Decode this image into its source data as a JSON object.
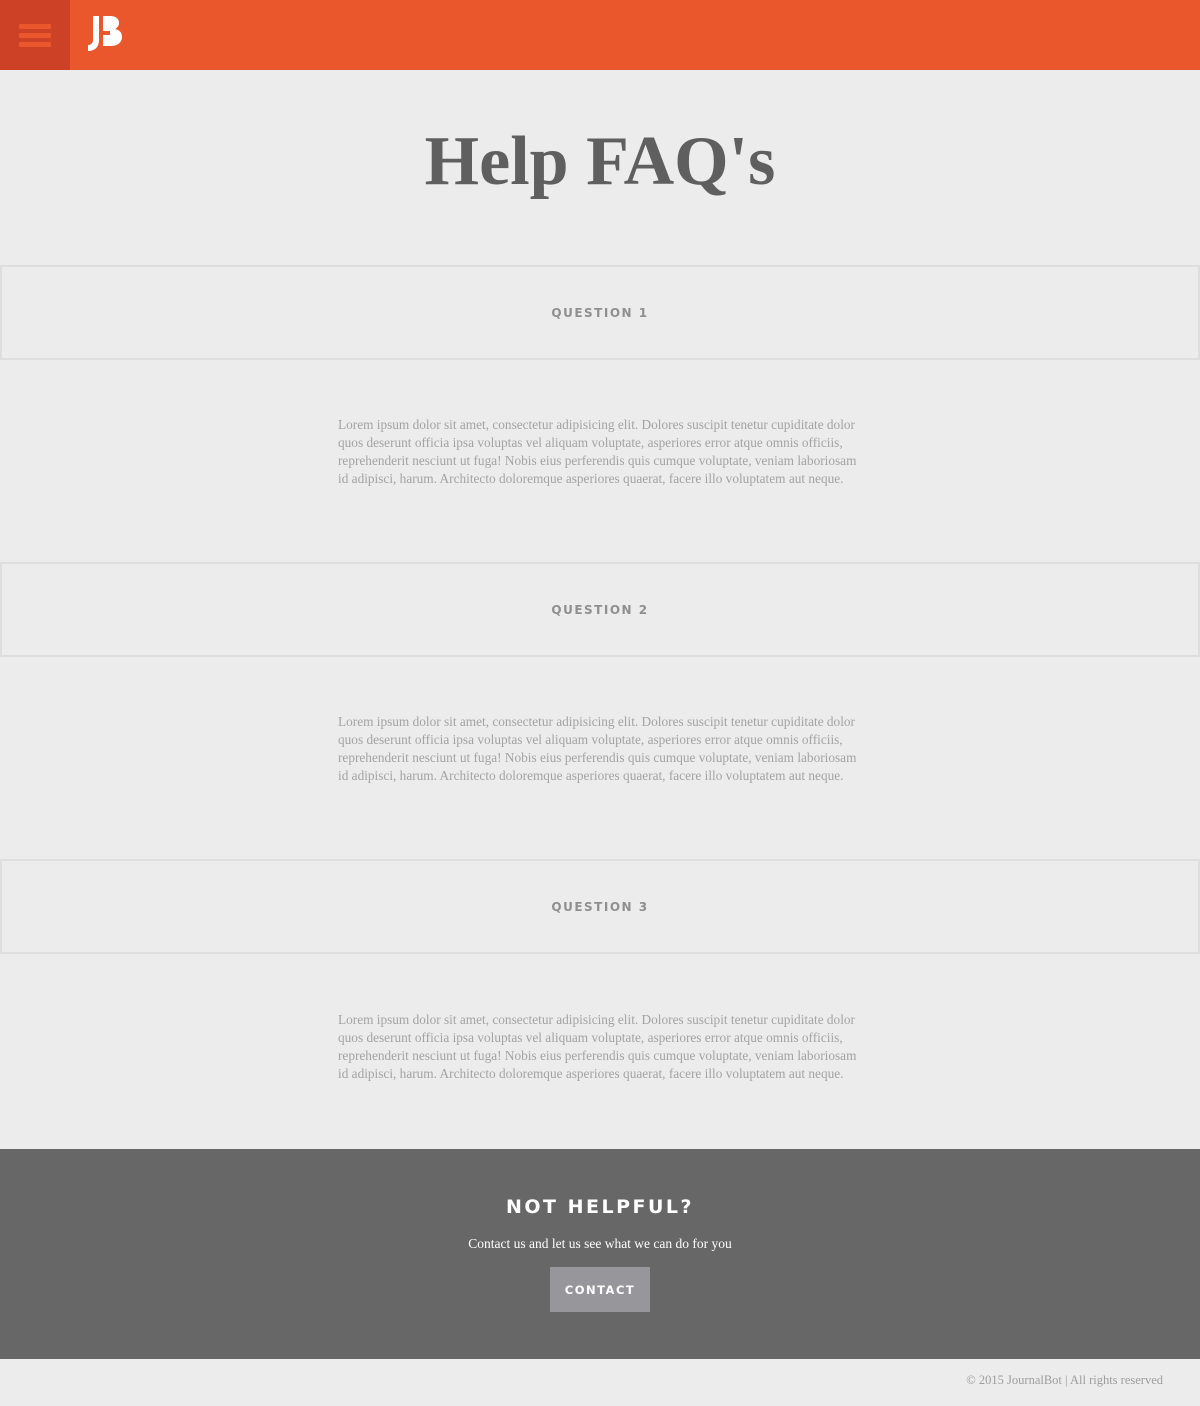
{
  "header": {
    "menu_icon": "hamburger-menu-icon",
    "logo_icon": "journalbot-jb-logo",
    "colors": {
      "bar": "#ea572d",
      "menu_bg": "#cd4126"
    }
  },
  "page": {
    "title": "Help FAQ's"
  },
  "faqs": [
    {
      "question": "QUESTION 1",
      "answer": "Lorem ipsum dolor sit amet, consectetur adipisicing elit. Dolores suscipit tenetur cupiditate dolor quos deserunt officia ipsa voluptas vel aliquam voluptate, asperiores error atque omnis officiis, reprehenderit nesciunt ut fuga! Nobis eius perferendis quis cumque voluptate, veniam laboriosam id adipisci, harum. Architecto doloremque asperiores quaerat, facere illo voluptatem aut neque."
    },
    {
      "question": "QUESTION 2",
      "answer": "Lorem ipsum dolor sit amet, consectetur adipisicing elit. Dolores suscipit tenetur cupiditate dolor quos deserunt officia ipsa voluptas vel aliquam voluptate, asperiores error atque omnis officiis, reprehenderit nesciunt ut fuga! Nobis eius perferendis quis cumque voluptate, veniam laboriosam id adipisci, harum. Architecto doloremque asperiores quaerat, facere illo voluptatem aut neque."
    },
    {
      "question": "QUESTION 3",
      "answer": "Lorem ipsum dolor sit amet, consectetur adipisicing elit. Dolores suscipit tenetur cupiditate dolor quos deserunt officia ipsa voluptas vel aliquam voluptate, asperiores error atque omnis officiis, reprehenderit nesciunt ut fuga! Nobis eius perferendis quis cumque voluptate, veniam laboriosam id adipisci, harum. Architecto doloremque asperiores quaerat, facere illo voluptatem aut neque."
    }
  ],
  "cta": {
    "title": "NOT HELPFUL?",
    "text": "Contact us and let us see what we can do for you",
    "button_label": "CONTACT"
  },
  "footer": {
    "copyright": "© 2015 JournalBot | All rights reserved"
  }
}
